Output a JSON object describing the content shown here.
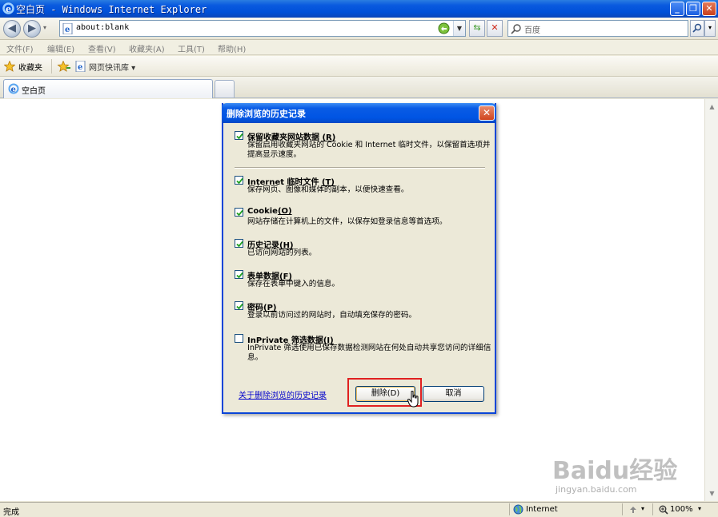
{
  "window": {
    "title": "空白页 - Windows Internet Explorer"
  },
  "address": {
    "url": "about:blank"
  },
  "search": {
    "placeholder": "百度"
  },
  "menu": {
    "items": [
      "文件(F)",
      "编辑(E)",
      "查看(V)",
      "收藏夹(A)",
      "工具(T)",
      "帮助(H)"
    ]
  },
  "favorites_bar": {
    "favorites_label": "收藏夹",
    "web_slice_label": "网页快讯库 ▾"
  },
  "tabs": [
    {
      "label": "空白页"
    }
  ],
  "dialog": {
    "title": "删除浏览的历史记录",
    "options": [
      {
        "label": "保留收藏夹网站数据",
        "key": "(R)",
        "checked": true,
        "description": "保留启用收藏夹网站的 Cookie 和 Internet 临时文件，以保留首选项并提高显示速度。"
      },
      {
        "label": "Internet 临时文件",
        "key": "(T)",
        "checked": true,
        "description": "保存网页、图像和媒体的副本，以便快速查看。"
      },
      {
        "label": "Cookie",
        "key": "(O)",
        "checked": true,
        "description": "网站存储在计算机上的文件，以保存如登录信息等首选项。"
      },
      {
        "label": "历史记录",
        "key": "(H)",
        "checked": true,
        "description": "已访问网站的列表。"
      },
      {
        "label": "表单数据",
        "key": "(F)",
        "checked": true,
        "description": "保存在表单中键入的信息。"
      },
      {
        "label": "密码",
        "key": "(P)",
        "checked": true,
        "description": "登录以前访问过的网站时，自动填充保存的密码。"
      },
      {
        "label": "InPrivate 筛选数据",
        "key": "(I)",
        "checked": false,
        "description": "InPrivate 筛选使用已保存数据检测网站在何处自动共享您访问的详细信息。"
      }
    ],
    "about_link": "关于删除浏览的历史记录",
    "delete_button": "删除(D)",
    "cancel_button": "取消"
  },
  "status": {
    "text": "完成",
    "zone": "Internet",
    "zoom": "100%"
  },
  "watermark": {
    "brand": "Baidu经验",
    "url": "jingyan.baidu.com"
  },
  "colors": {
    "titlebar": "#0054e3",
    "highlight": "#e02020",
    "link": "#0000cc"
  }
}
